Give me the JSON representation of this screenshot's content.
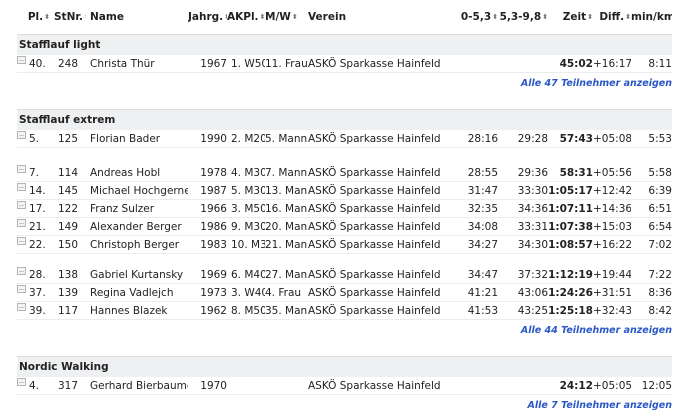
{
  "headers": {
    "pl": "Pl.",
    "stnr": "StNr.",
    "name": "Name",
    "jahrg": "Jahrg.",
    "akpl": "AKPl.",
    "mw": "M/W",
    "verein": "Verein",
    "s1": "0-5,3",
    "s2": "5,3-9,8",
    "zeit": "Zeit",
    "diff": "Diff.",
    "mink": "min/km"
  },
  "sections": [
    {
      "title": "Stafflauf light",
      "rows": [
        {
          "pl": "40.",
          "stnr": "248",
          "name": "Christa Thür",
          "jahrg": "1967",
          "akpl": "1. W50",
          "mw": "11. Frau",
          "verein": "ASKÖ Sparkasse Hainfeld",
          "s1": "",
          "s2": "",
          "zeit": "45:02",
          "diff": "+16:17",
          "mink": "8:11"
        }
      ],
      "more": "Alle 47 Teilnehmer anzeigen"
    },
    {
      "title": "Stafflauf extrem",
      "rows": [
        {
          "pl": "5.",
          "stnr": "125",
          "name": "Florian Bader",
          "jahrg": "1990",
          "akpl": "2. M20",
          "mw": "5. Mann",
          "verein": "ASKÖ Sparkasse Hainfeld",
          "s1": "28:16",
          "s2": "29:28",
          "zeit": "57:43",
          "diff": "+05:08",
          "mink": "5:53"
        },
        {
          "pl": "7.",
          "stnr": "114",
          "name": "Andreas Hobl",
          "jahrg": "1978",
          "akpl": "4. M30",
          "mw": "7. Mann",
          "verein": "ASKÖ Sparkasse Hainfeld",
          "s1": "28:55",
          "s2": "29:36",
          "zeit": "58:31",
          "diff": "+05:56",
          "mink": "5:58"
        },
        {
          "pl": "14.",
          "stnr": "145",
          "name": "Michael Hochgerner",
          "jahrg": "1987",
          "akpl": "5. M30",
          "mw": "13. Mann",
          "verein": "ASKÖ Sparkasse Hainfeld",
          "s1": "31:47",
          "s2": "33:30",
          "zeit": "1:05:17",
          "diff": "+12:42",
          "mink": "6:39"
        },
        {
          "pl": "17.",
          "stnr": "122",
          "name": "Franz Sulzer",
          "jahrg": "1966",
          "akpl": "3. M50",
          "mw": "16. Mann",
          "verein": "ASKÖ Sparkasse Hainfeld",
          "s1": "32:35",
          "s2": "34:36",
          "zeit": "1:07:11",
          "diff": "+14:36",
          "mink": "6:51"
        },
        {
          "pl": "21.",
          "stnr": "149",
          "name": "Alexander Berger",
          "jahrg": "1986",
          "akpl": "9. M30",
          "mw": "20. Mann",
          "verein": "ASKÖ Sparkasse Hainfeld",
          "s1": "34:08",
          "s2": "33:31",
          "zeit": "1:07:38",
          "diff": "+15:03",
          "mink": "6:54"
        },
        {
          "pl": "22.",
          "stnr": "150",
          "name": "Christoph Berger",
          "jahrg": "1983",
          "akpl": "10. M30",
          "mw": "21. Mann",
          "verein": "ASKÖ Sparkasse Hainfeld",
          "s1": "34:27",
          "s2": "34:30",
          "zeit": "1:08:57",
          "diff": "+16:22",
          "mink": "7:02"
        },
        {
          "pl": "28.",
          "stnr": "138",
          "name": "Gabriel Kurtansky",
          "jahrg": "1969",
          "akpl": "6. M40",
          "mw": "27. Mann",
          "verein": "ASKÖ Sparkasse Hainfeld",
          "s1": "34:47",
          "s2": "37:32",
          "zeit": "1:12:19",
          "diff": "+19:44",
          "mink": "7:22"
        },
        {
          "pl": "37.",
          "stnr": "139",
          "name": "Regina Vadlejch",
          "jahrg": "1973",
          "akpl": "3. W40",
          "mw": "4. Frau",
          "verein": "ASKÖ Sparkasse Hainfeld",
          "s1": "41:21",
          "s2": "43:06",
          "zeit": "1:24:26",
          "diff": "+31:51",
          "mink": "8:36"
        },
        {
          "pl": "39.",
          "stnr": "117",
          "name": "Hannes Blazek",
          "jahrg": "1962",
          "akpl": "8. M50",
          "mw": "35. Mann",
          "verein": "ASKÖ Sparkasse Hainfeld",
          "s1": "41:53",
          "s2": "43:25",
          "zeit": "1:25:18",
          "diff": "+32:43",
          "mink": "8:42"
        }
      ],
      "more": "Alle 44 Teilnehmer anzeigen"
    },
    {
      "title": "Nordic Walking",
      "rows": [
        {
          "pl": "4.",
          "stnr": "317",
          "name": "Gerhard Bierbaumer",
          "jahrg": "1970",
          "akpl": "",
          "mw": "",
          "verein": "ASKÖ Sparkasse Hainfeld",
          "s1": "",
          "s2": "",
          "zeit": "24:12",
          "diff": "+05:05",
          "mink": "12:05"
        }
      ],
      "more": "Alle 7 Teilnehmer anzeigen"
    }
  ]
}
